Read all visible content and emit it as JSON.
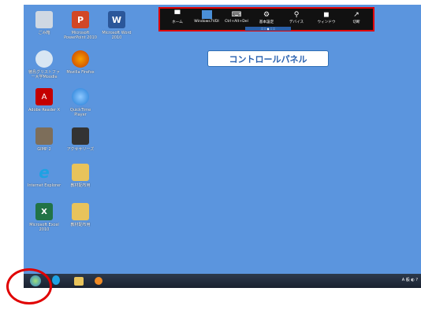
{
  "desktop_icons": [
    {
      "name": "recycle-bin-icon",
      "label": "ごみ箱",
      "color": "#cfd8e3"
    },
    {
      "name": "powerpoint-icon",
      "label": "Microsoft\nPowerPoint 2010",
      "color": "#d24726"
    },
    {
      "name": "word-icon",
      "label": "Microsoft Word\n2010",
      "color": "#2b579a"
    },
    {
      "name": "moodle-icon",
      "label": "徳島グリストファ\nー大学Moodle",
      "color": "#d8e6f3"
    },
    {
      "name": "firefox-icon",
      "label": "Mozilla Firefox",
      "color": "#e66000"
    },
    {
      "name": "adobe-reader-icon",
      "label": "Adobe Reader X",
      "color": "#c40000"
    },
    {
      "name": "quicktime-icon",
      "label": "QuickTime\nPlayer",
      "color": "#1f7bd6"
    },
    {
      "name": "gimp-icon",
      "label": "GIMP 2",
      "color": "#7d6e5a"
    },
    {
      "name": "accessories-icon",
      "label": "アクセサリーズ",
      "color": "#333333"
    },
    {
      "name": "internet-explorer-icon",
      "label": "Internet Explorer",
      "color": "#1ea2e3"
    },
    {
      "name": "folder-icon",
      "label": "教材配布用",
      "color": "#e8c35b"
    },
    {
      "name": "excel-icon",
      "label": "Microsoft Excel\n2010",
      "color": "#217346"
    },
    {
      "name": "folder-icon-2",
      "label": "教材配布用",
      "color": "#e8c35b"
    }
  ],
  "remote_bar": {
    "items": [
      {
        "name": "home-button",
        "label": "ホーム",
        "icon": "▀"
      },
      {
        "name": "windows-vdi-button",
        "label": "Windows7VDI",
        "icon": "▬"
      },
      {
        "name": "ctrl-alt-del-button",
        "label": "Ctrl+Alt+Del",
        "icon": "⌨"
      },
      {
        "name": "settings-button",
        "label": "基本設定",
        "icon": "⚙"
      },
      {
        "name": "devices-button",
        "label": "デバイス",
        "icon": "⚲"
      },
      {
        "name": "window-button",
        "label": "ウィンドウ",
        "icon": "◼"
      },
      {
        "name": "disconnect-button",
        "label": "切断",
        "icon": "↗"
      }
    ],
    "handle": "::::: ◆ :::::",
    "border_color": "#e10000"
  },
  "callout": {
    "text": "コントロールパネル"
  },
  "taskbar": {
    "tray_text": "A 般 ◐ ?"
  }
}
